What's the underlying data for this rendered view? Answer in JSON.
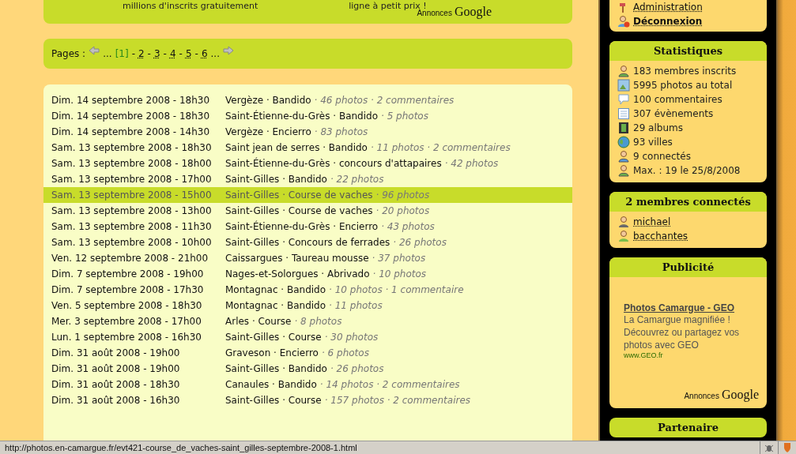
{
  "top_ad": {
    "lines": [
      "millions d'inscrits gratuitement",
      "ligne à petit prix !"
    ],
    "label": "Annonces",
    "brand": "Google"
  },
  "pagination": {
    "label": "Pages :",
    "parts": [
      {
        "kind": "prev"
      },
      {
        "kind": "text",
        "text": "..."
      },
      {
        "kind": "page",
        "text": "[1]",
        "selected": true
      },
      {
        "kind": "text",
        "text": "-"
      },
      {
        "kind": "page",
        "text": "2",
        "selected": false
      },
      {
        "kind": "text",
        "text": "-"
      },
      {
        "kind": "page",
        "text": "3",
        "selected": false
      },
      {
        "kind": "text",
        "text": "-"
      },
      {
        "kind": "page",
        "text": "4",
        "selected": false
      },
      {
        "kind": "text",
        "text": "-"
      },
      {
        "kind": "page",
        "text": "5",
        "selected": false
      },
      {
        "kind": "text",
        "text": "-"
      },
      {
        "kind": "page",
        "text": "6",
        "selected": false
      },
      {
        "kind": "text",
        "text": "..."
      },
      {
        "kind": "next"
      }
    ]
  },
  "events": [
    {
      "date": "Dim. 14 septembre 2008 - 18h30",
      "place": "Vergèze · Bandido",
      "stats": "· 46 photos · 2 commentaires",
      "selected": false
    },
    {
      "date": "Dim. 14 septembre 2008 - 18h30",
      "place": "Saint-Étienne-du-Grès · Bandido",
      "stats": "· 5 photos",
      "selected": false
    },
    {
      "date": "Dim. 14 septembre 2008 - 14h30",
      "place": "Vergèze · Encierro",
      "stats": "· 83 photos",
      "selected": false
    },
    {
      "date": "Sam. 13 septembre 2008 - 18h30",
      "place": "Saint jean de serres · Bandido",
      "stats": "· 11 photos · 2 commentaires",
      "selected": false
    },
    {
      "date": "Sam. 13 septembre 2008 - 18h00",
      "place": "Saint-Étienne-du-Grès · concours d'attapaires",
      "stats": "· 42 photos",
      "selected": false
    },
    {
      "date": "Sam. 13 septembre 2008 - 17h00",
      "place": "Saint-Gilles · Bandido",
      "stats": "· 22 photos",
      "selected": false
    },
    {
      "date": "Sam. 13 septembre 2008 - 15h00",
      "place": "Saint-Gilles · Course de vaches",
      "stats": "· 96 photos",
      "selected": true
    },
    {
      "date": "Sam. 13 septembre 2008 - 13h00",
      "place": "Saint-Gilles · Course de vaches",
      "stats": "· 20 photos",
      "selected": false
    },
    {
      "date": "Sam. 13 septembre 2008 - 11h30",
      "place": "Saint-Étienne-du-Grès · Encierro",
      "stats": "· 43 photos",
      "selected": false
    },
    {
      "date": "Sam. 13 septembre 2008 - 10h00",
      "place": "Saint-Gilles · Concours de ferrades",
      "stats": "· 26 photos",
      "selected": false
    },
    {
      "date": "Ven. 12 septembre 2008 - 21h00",
      "place": "Caissargues · Taureau mousse",
      "stats": "· 37 photos",
      "selected": false
    },
    {
      "date": "Dim. 7 septembre 2008 - 19h00",
      "place": "Nages-et-Solorgues · Abrivado",
      "stats": "· 10 photos",
      "selected": false
    },
    {
      "date": "Dim. 7 septembre 2008 - 17h30",
      "place": "Montagnac · Bandido",
      "stats": "· 10 photos · 1 commentaire",
      "selected": false
    },
    {
      "date": "Ven. 5 septembre 2008 - 18h30",
      "place": "Montagnac · Bandido",
      "stats": "· 11 photos",
      "selected": false
    },
    {
      "date": "Mer. 3 septembre 2008 - 17h00",
      "place": "Arles · Course",
      "stats": "· 8 photos",
      "selected": false
    },
    {
      "date": "Lun. 1 septembre 2008 - 16h30",
      "place": "Saint-Gilles · Course",
      "stats": "· 30 photos",
      "selected": false
    },
    {
      "date": "Dim. 31 août 2008 - 19h00",
      "place": "Graveson · Encierro",
      "stats": "· 6 photos",
      "selected": false
    },
    {
      "date": "Dim. 31 août 2008 - 19h00",
      "place": "Saint-Gilles · Bandido",
      "stats": "· 26 photos",
      "selected": false
    },
    {
      "date": "Dim. 31 août 2008 - 18h30",
      "place": "Canaules · Bandido",
      "stats": "· 14 photos · 2 commentaires",
      "selected": false
    },
    {
      "date": "Dim. 31 août 2008 - 16h30",
      "place": "Saint-Gilles · Course",
      "stats": "· 157 photos · 2 commentaires",
      "selected": false
    }
  ],
  "sidebar": {
    "account": [
      {
        "label": "Administration",
        "kind": "admin",
        "bold": false
      },
      {
        "label": "Déconnexion",
        "kind": "logout",
        "bold": true
      }
    ],
    "statistics": {
      "title": "Statistiques",
      "items": [
        {
          "text": "183 membres inscrits",
          "kind": "members"
        },
        {
          "text": "5995 photos au total",
          "kind": "photo"
        },
        {
          "text": "100 commentaires",
          "kind": "comment"
        },
        {
          "text": "307 évènements",
          "kind": "calendar"
        },
        {
          "text": "29 albums",
          "kind": "film"
        },
        {
          "text": "93 villes",
          "kind": "globe"
        },
        {
          "text": "9 connectés",
          "kind": "connected"
        },
        {
          "text": "Max. : 19 le 25/8/2008",
          "kind": "max"
        }
      ]
    },
    "connected": {
      "title": "2 membres connectés",
      "members": [
        {
          "name": "michael",
          "color": "#6a6a6a"
        },
        {
          "name": "bacchantes",
          "color": "#7cbf4a"
        }
      ]
    },
    "ad": {
      "title": "Publicité",
      "link": "Photos Camargue - GEO",
      "lines": [
        "La Camargue magnifiée !",
        "Découvrez ou partagez vos photos avec GEO"
      ],
      "url": "www.GEO.fr",
      "label": "Annonces",
      "brand": "Google"
    },
    "partner": {
      "title": "Partenaire"
    }
  },
  "status_bar": {
    "url": "http://photos.en-camargue.fr/evt421-course_de_vaches-saint_gilles-septembre-2008-1.html"
  }
}
